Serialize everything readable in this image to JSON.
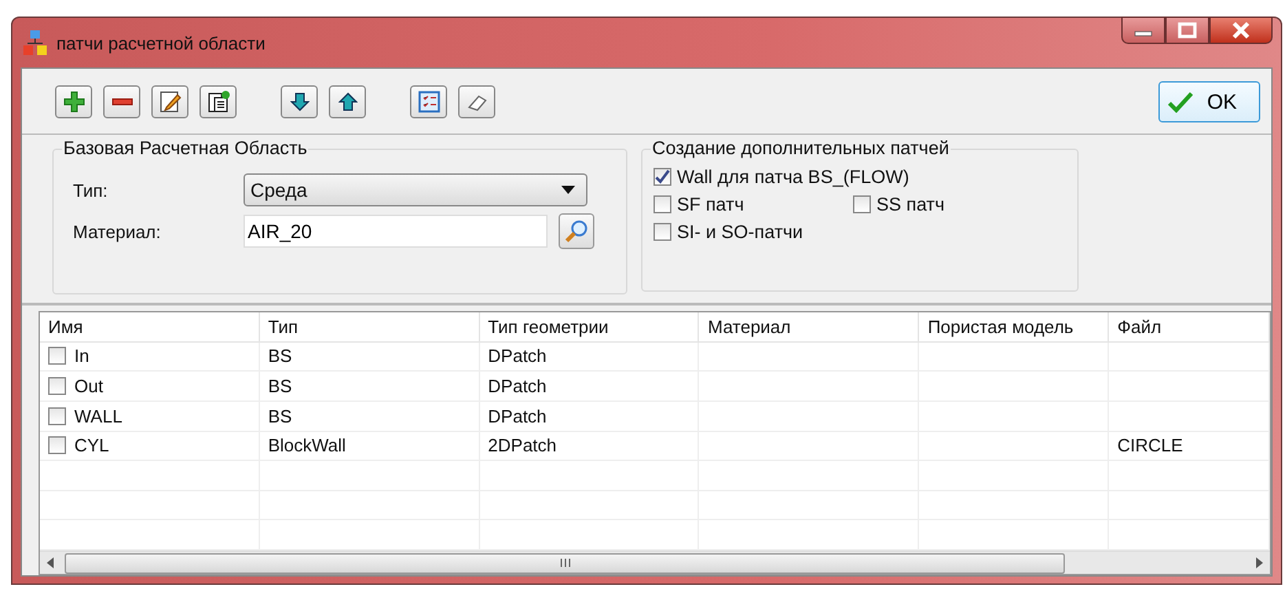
{
  "window": {
    "title": "патчи расчетной области"
  },
  "toolbar": [
    {
      "kind": "add"
    },
    {
      "kind": "remove"
    },
    {
      "kind": "edit"
    },
    {
      "kind": "paste"
    },
    {
      "kind": "gap"
    },
    {
      "kind": "down"
    },
    {
      "kind": "up"
    },
    {
      "kind": "gap"
    },
    {
      "kind": "checklist"
    },
    {
      "kind": "eraser"
    }
  ],
  "ok_button": "OK",
  "base_group": {
    "title": "Базовая Расчетная Область",
    "type_label": "Тип:",
    "type_value": "Среда",
    "material_label": "Материал:",
    "material_value": "AIR_20"
  },
  "extra_group": {
    "title": "Создание дополнительных патчей",
    "options": [
      {
        "label": "Wall для патча BS_(FLOW)",
        "checked": true
      },
      {
        "label": "SF патч",
        "checked": false
      },
      {
        "label": "SS патч",
        "checked": false
      },
      {
        "label": "SI- и SO-патчи",
        "checked": false
      }
    ]
  },
  "table": {
    "columns": [
      "Имя",
      "Тип",
      "Тип геометрии",
      "Материал",
      "Пористая модель",
      "Файл"
    ],
    "rows": [
      {
        "checked": false,
        "cells": [
          "In",
          "BS",
          "DPatch",
          "",
          "",
          ""
        ]
      },
      {
        "checked": false,
        "cells": [
          "Out",
          "BS",
          "DPatch",
          "",
          "",
          ""
        ]
      },
      {
        "checked": false,
        "cells": [
          "WALL",
          "BS",
          "DPatch",
          "",
          "",
          ""
        ]
      },
      {
        "checked": false,
        "cells": [
          "CYL",
          "BlockWall",
          "2DPatch",
          "",
          "",
          "CIRCLE"
        ]
      }
    ]
  }
}
